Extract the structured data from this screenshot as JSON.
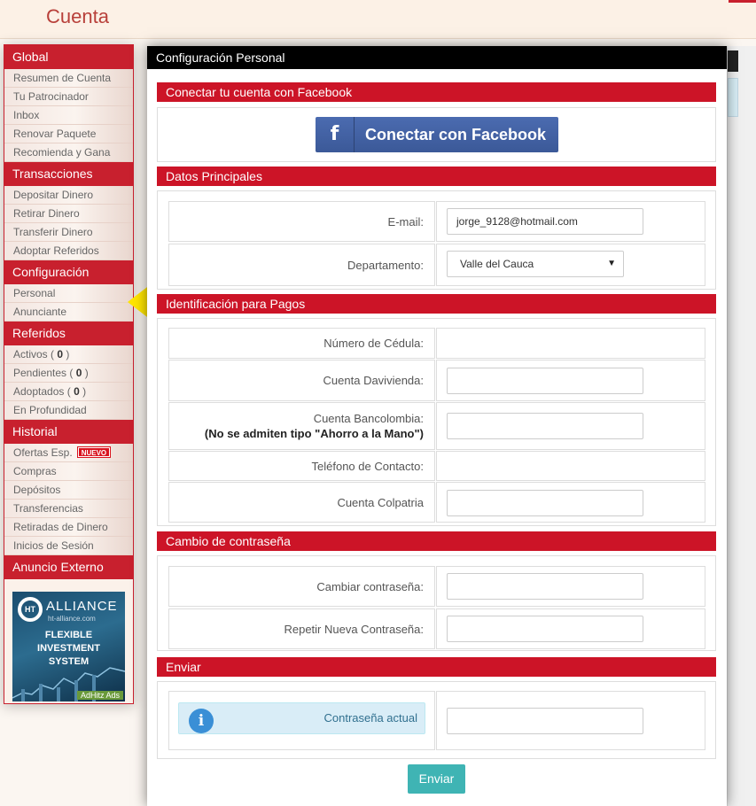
{
  "header": {
    "title": "Cuenta"
  },
  "sidebar": {
    "global": {
      "title": "Global",
      "items": [
        "Resumen de Cuenta",
        "Tu Patrocinador",
        "Inbox",
        "Renovar Paquete",
        "Recomienda y Gana"
      ]
    },
    "transacciones": {
      "title": "Transacciones",
      "items": [
        "Depositar Dinero",
        "Retirar Dinero",
        "Transferir Dinero",
        "Adoptar Referidos"
      ]
    },
    "configuracion": {
      "title": "Configuración",
      "items": [
        "Personal",
        "Anunciante"
      ]
    },
    "referidos": {
      "title": "Referidos",
      "activos_label": "Activos (",
      "activos_count": "0",
      "pendientes_label": "Pendientes (",
      "pendientes_count": "0",
      "adoptados_label": "Adoptados (",
      "adoptados_count": "0",
      "close_paren": ")",
      "profundidad": "En Profundidad"
    },
    "historial": {
      "title": "Historial",
      "ofertas": "Ofertas Esp.",
      "new_badge": "NUEVO",
      "items": [
        "Compras",
        "Depósitos",
        "Transferencias",
        "Retiradas de Dinero",
        "Inicios de Sesión"
      ]
    },
    "anuncio": {
      "title": "Anuncio Externo",
      "ad_logo": "HT",
      "ad_brand": "ALLIANCE",
      "ad_url": "ht-alliance.com",
      "ad_headline_1": "FLEXIBLE INVESTMENT",
      "ad_headline_2": "SYSTEM",
      "ad_network": "AdHitz Ads"
    }
  },
  "modal": {
    "title": "Configuración Personal",
    "facebook": {
      "section": "Conectar tu cuenta con Facebook",
      "icon_glyph": "f",
      "button": "Conectar con Facebook"
    },
    "datos": {
      "section": "Datos Principales",
      "email_label": "E-mail:",
      "email_value": "jorge_9128@hotmail.com",
      "departamento_label": "Departamento:",
      "departamento_value": "Valle del Cauca"
    },
    "pagos": {
      "section": "Identificación para Pagos",
      "cedula_label": "Número de Cédula:",
      "davivienda_label": "Cuenta Davivienda:",
      "bancolombia_label": "Cuenta Bancolombia:",
      "bancolombia_note": "(No se admiten tipo \"Ahorro a la Mano\")",
      "telefono_label": "Teléfono de Contacto:",
      "colpatria_label": "Cuenta Colpatria"
    },
    "contrasena": {
      "section": "Cambio de contraseña",
      "cambiar_label": "Cambiar contraseña:",
      "repetir_label": "Repetir Nueva Contraseña:"
    },
    "enviar": {
      "section": "Enviar",
      "info_glyph": "i",
      "actual_label": "Contraseña actual",
      "button": "Enviar"
    }
  },
  "colors": {
    "brand_red": "#cc1427",
    "facebook_blue": "#3b5998",
    "send_teal": "#3fb4b4",
    "info_bg": "#d9edf7",
    "arrow_yellow": "#ffe500"
  }
}
